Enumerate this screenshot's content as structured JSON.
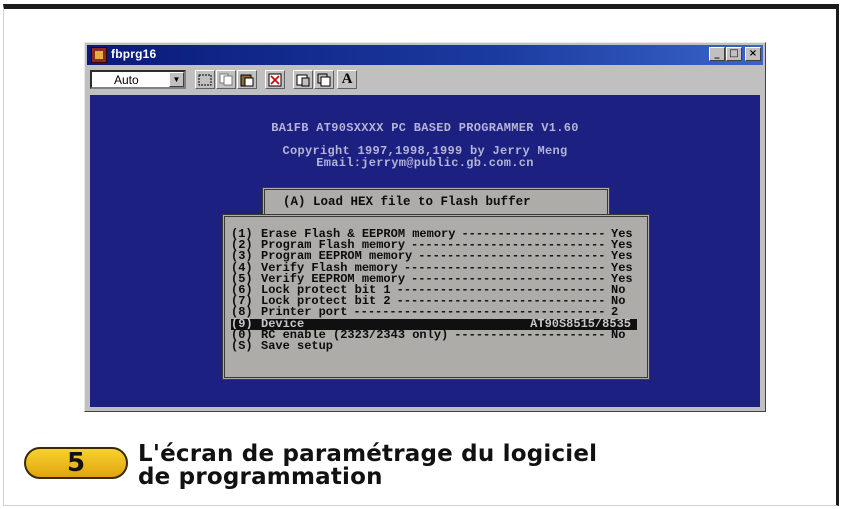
{
  "window": {
    "title": "fbprg16",
    "title_buttons": [
      "_",
      "□",
      "×"
    ]
  },
  "toolbar": {
    "font_combo_value": "Auto",
    "font_button_label": "A"
  },
  "screen": {
    "header": "BA1FB AT90SXXXX PC BASED PROGRAMMER V1.60",
    "copyright": "Copyright 1997,1998,1999 by Jerry Meng",
    "email": "Email:jerrym@public.gb.com.cn",
    "top_item": {
      "key": "(A)",
      "label": "Load HEX file to Flash buffer"
    },
    "menu": [
      {
        "key": "(1)",
        "label": "Erase Flash & EEPROM memory",
        "value": "Yes"
      },
      {
        "key": "(2)",
        "label": "Program Flash memory",
        "value": "Yes"
      },
      {
        "key": "(3)",
        "label": "Program EEPROM memory",
        "value": "Yes"
      },
      {
        "key": "(4)",
        "label": "Verify Flash memory",
        "value": "Yes"
      },
      {
        "key": "(5)",
        "label": "Verify EEPROM memory",
        "value": "Yes"
      },
      {
        "key": "(6)",
        "label": "Lock protect bit 1",
        "value": "No"
      },
      {
        "key": "(7)",
        "label": "Lock protect bit 2",
        "value": "No"
      },
      {
        "key": "(8)",
        "label": "Printer port",
        "value": "2"
      },
      {
        "key": "(9)",
        "label": "Device",
        "value": "AT90S8515/8535"
      },
      {
        "key": "(0)",
        "label": "RC enable (2323/2343 only)",
        "value": "No"
      },
      {
        "key": "(S)",
        "label": "Save setup",
        "value": ""
      }
    ],
    "selected_index": 8
  },
  "caption": {
    "number": "5",
    "line1": "L'écran de paramétrage du logiciel",
    "line2": "de programmation"
  },
  "colors": {
    "screen_bg": "#1c2080",
    "menu_bg": "#aeaca8",
    "badge": "#f2c62a"
  }
}
